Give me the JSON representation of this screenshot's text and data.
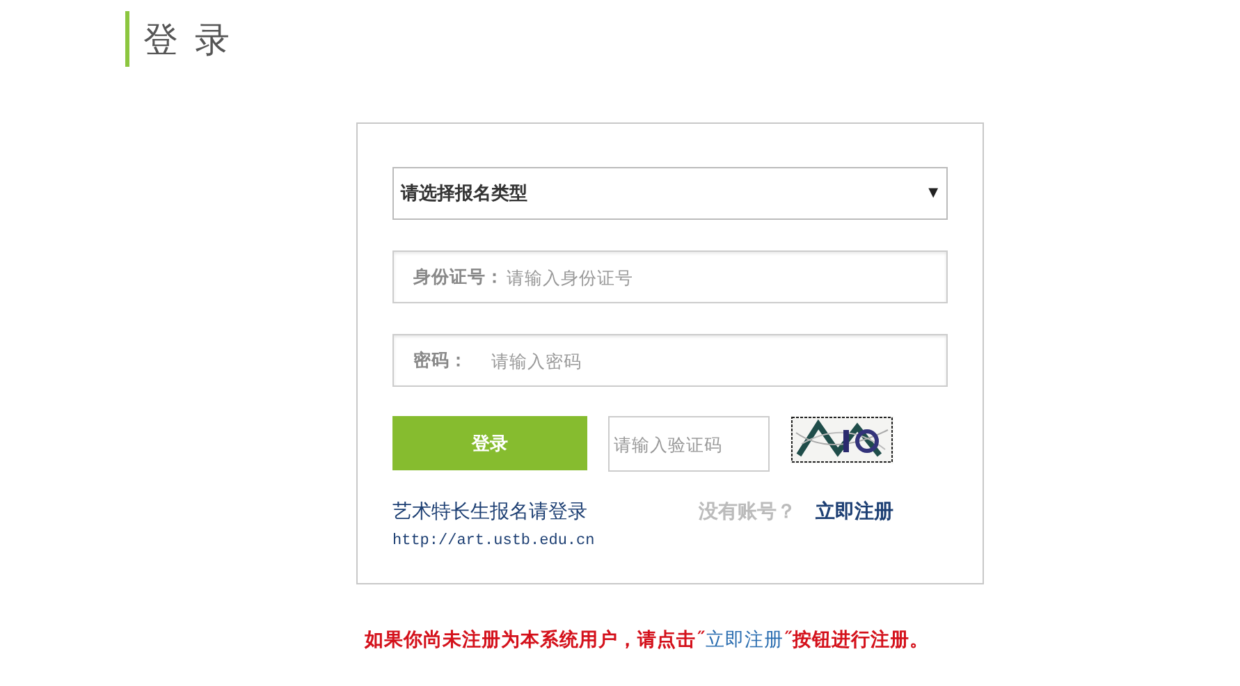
{
  "header": {
    "title": "登 录"
  },
  "form": {
    "type_select": {
      "value": "请选择报名类型",
      "arrow": "▼"
    },
    "fields": [
      {
        "label": "身份证号：",
        "placeholder": "请输入身份证号",
        "kind": "text"
      },
      {
        "label": "密码：",
        "placeholder": "请输入密码",
        "kind": "password"
      }
    ],
    "login_button": "登录",
    "captcha": {
      "placeholder": "请输入验证码"
    },
    "site_title": "艺术特长生报名请登录",
    "site_url": "http://art.ustb.edu.cn",
    "no_account": "没有账号？",
    "register_link": "立即注册"
  },
  "notice": {
    "before": "如果你尚未注册为本系统用户，请点击˝",
    "link": "立即注册",
    "after": "˝按钮进行注册。"
  }
}
